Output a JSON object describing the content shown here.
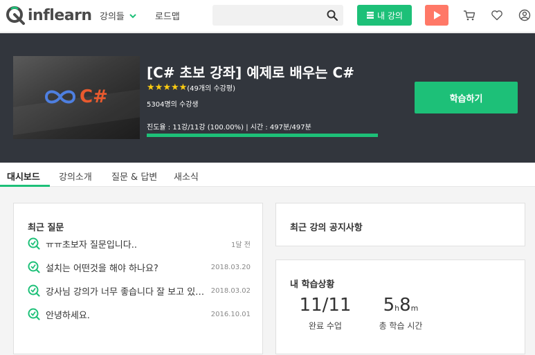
{
  "header": {
    "logo_text": "inflearn",
    "nav_courses": "강의들",
    "nav_roadmap": "로드맵",
    "search_placeholder": "",
    "my_course_label": "내 강의",
    "icons": [
      "search-icon",
      "play-icon",
      "cart-icon",
      "heart-icon",
      "user-icon"
    ]
  },
  "course": {
    "thumbnail_text": "C#",
    "title": "[C# 초보 강좌] 예제로 배우는 C#",
    "stars": 5,
    "rating_count": "(49개의 수강평)",
    "students": "5304명의 수강생",
    "progress_text": "진도율 : 11강/11강 (100.00%) | 시간 : 497분/497분",
    "progress_percent": 100,
    "study_button": "학습하기"
  },
  "tabs": [
    "대시보드",
    "강의소개",
    "질문 & 답변",
    "새소식"
  ],
  "recent_questions": {
    "title": "최근 질문",
    "items": [
      {
        "text": "ㅠㅠ초보자 질문입니다..",
        "date": "1달 전"
      },
      {
        "text": "설치는 어떤것을 해야 하나요?",
        "date": "2018.03.20"
      },
      {
        "text": "강사님 강의가 너무 좋습니다 잘 보고 있습니다",
        "date": "2018.03.02"
      },
      {
        "text": "안녕하세요.",
        "date": "2016.10.01"
      }
    ]
  },
  "notices": {
    "title": "최근 강의 공지사항"
  },
  "my_progress": {
    "title": "내 학습상황",
    "completed_value": "11/11",
    "completed_label": "완료 수업",
    "time_hours": "5",
    "time_hours_unit": "h",
    "time_minutes": "8",
    "time_minutes_unit": "m",
    "time_label": "총 학습 시간"
  },
  "colors": {
    "brand_green": "#1dc078",
    "play_red": "#ff7867",
    "hero_bg": "#32363d",
    "star": "#fdcc11"
  }
}
